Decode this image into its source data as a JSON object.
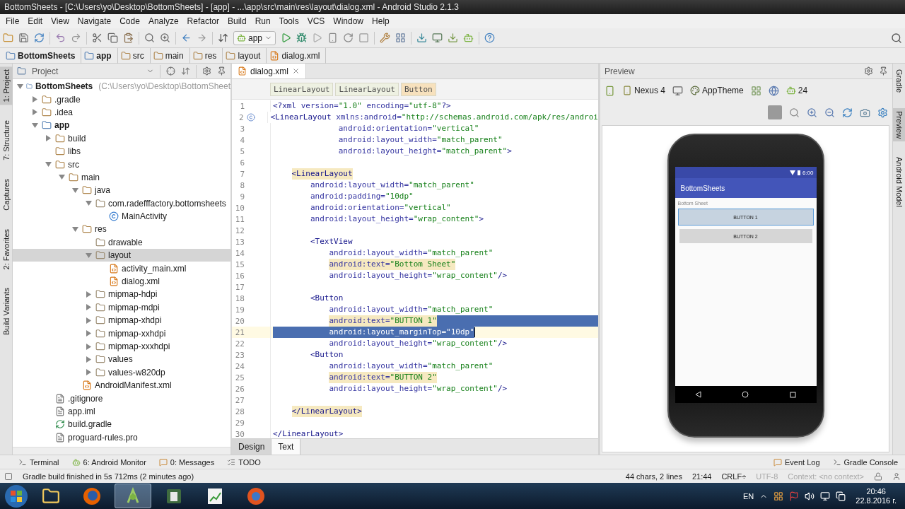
{
  "window": {
    "title": "BottomSheets - [C:\\Users\\yo\\Desktop\\BottomSheets] - [app] - ...\\app\\src\\main\\res\\layout\\dialog.xml - Android Studio 2.1.3"
  },
  "menu": [
    "File",
    "Edit",
    "View",
    "Navigate",
    "Code",
    "Analyze",
    "Refactor",
    "Build",
    "Run",
    "Tools",
    "VCS",
    "Window",
    "Help"
  ],
  "toolbar": {
    "run_config": "app"
  },
  "breadcrumb": [
    {
      "label": "BottomSheets",
      "kind": "module"
    },
    {
      "label": "app",
      "kind": "module"
    },
    {
      "label": "src",
      "kind": "folder"
    },
    {
      "label": "main",
      "kind": "folder"
    },
    {
      "label": "res",
      "kind": "folder"
    },
    {
      "label": "layout",
      "kind": "folder"
    },
    {
      "label": "dialog.xml",
      "kind": "xml"
    }
  ],
  "left_stripe": [
    {
      "label": "1: Project",
      "selected": true
    },
    {
      "label": "7: Structure",
      "selected": false
    },
    {
      "label": "Captures",
      "selected": false
    },
    {
      "label": "2: Favorites",
      "selected": false
    },
    {
      "label": "Build Variants",
      "selected": false
    }
  ],
  "project": {
    "title": "Project",
    "tree": [
      {
        "label": "BottomSheets",
        "path": "(C:\\Users\\yo\\Desktop\\BottomSheet",
        "kind": "module",
        "expanded": true,
        "selected": false,
        "children": [
          {
            "label": ".gradle",
            "kind": "folder",
            "expanded": false,
            "selected": false
          },
          {
            "label": ".idea",
            "kind": "folder",
            "expanded": false,
            "selected": false
          },
          {
            "label": "app",
            "kind": "module",
            "expanded": true,
            "selected": false,
            "children": [
              {
                "label": "build",
                "kind": "folder",
                "expanded": false,
                "selected": false
              },
              {
                "label": "libs",
                "kind": "folder",
                "selected": false
              },
              {
                "label": "src",
                "kind": "folder",
                "expanded": true,
                "selected": false,
                "children": [
                  {
                    "label": "main",
                    "kind": "folder",
                    "expanded": true,
                    "selected": false,
                    "children": [
                      {
                        "label": "java",
                        "kind": "folder",
                        "expanded": true,
                        "selected": false,
                        "children": [
                          {
                            "label": "com.radefffactory.bottomsheets",
                            "kind": "package",
                            "expanded": true,
                            "selected": false,
                            "children": [
                              {
                                "label": "MainActivity",
                                "kind": "class",
                                "selected": false
                              }
                            ]
                          }
                        ]
                      },
                      {
                        "label": "res",
                        "kind": "folder",
                        "expanded": true,
                        "selected": false,
                        "children": [
                          {
                            "label": "drawable",
                            "kind": "package",
                            "selected": false
                          },
                          {
                            "label": "layout",
                            "kind": "package",
                            "expanded": true,
                            "selected": true,
                            "children": [
                              {
                                "label": "activity_main.xml",
                                "kind": "xml",
                                "selected": false
                              },
                              {
                                "label": "dialog.xml",
                                "kind": "xml",
                                "selected": false
                              }
                            ]
                          },
                          {
                            "label": "mipmap-hdpi",
                            "kind": "package",
                            "expanded": false,
                            "selected": false
                          },
                          {
                            "label": "mipmap-mdpi",
                            "kind": "package",
                            "expanded": false,
                            "selected": false
                          },
                          {
                            "label": "mipmap-xhdpi",
                            "kind": "package",
                            "expanded": false,
                            "selected": false
                          },
                          {
                            "label": "mipmap-xxhdpi",
                            "kind": "package",
                            "expanded": false,
                            "selected": false
                          },
                          {
                            "label": "mipmap-xxxhdpi",
                            "kind": "package",
                            "expanded": false,
                            "selected": false
                          },
                          {
                            "label": "values",
                            "kind": "package",
                            "expanded": false,
                            "selected": false
                          },
                          {
                            "label": "values-w820dp",
                            "kind": "package",
                            "expanded": false,
                            "selected": false
                          }
                        ]
                      },
                      {
                        "label": "AndroidManifest.xml",
                        "kind": "xml",
                        "selected": false
                      }
                    ]
                  }
                ]
              },
              {
                "label": ".gitignore",
                "kind": "file",
                "selected": false
              },
              {
                "label": "app.iml",
                "kind": "file",
                "selected": false
              },
              {
                "label": "build.gradle",
                "kind": "gradle",
                "selected": false
              },
              {
                "label": "proguard-rules.pro",
                "kind": "file",
                "selected": false
              }
            ]
          }
        ]
      }
    ]
  },
  "editor": {
    "tabs": [
      {
        "label": "dialog.xml",
        "selected": true
      }
    ],
    "path": [
      {
        "label": "LinearLayout",
        "selected": false
      },
      {
        "label": "LinearLayout",
        "selected": false
      },
      {
        "label": "Button",
        "selected": true
      }
    ],
    "lines": [
      {
        "number": "1",
        "segments": [
          {
            "kind": "tag",
            "text": "<?xml"
          },
          {
            "kind": "attr",
            "text": " version="
          },
          {
            "kind": "value",
            "text": "\"1.0\""
          },
          {
            "kind": "attr",
            "text": " encoding="
          },
          {
            "kind": "value",
            "text": "\"utf-8\""
          },
          {
            "kind": "tag",
            "text": "?>"
          }
        ]
      },
      {
        "number": "2",
        "has_marker": true,
        "segments": [
          {
            "kind": "tag",
            "text": "<LinearLayout"
          },
          {
            "kind": "attr",
            "text": " xmlns:android="
          },
          {
            "kind": "value",
            "text": "\"http://schemas.android.com/apk/res/androi"
          }
        ]
      },
      {
        "number": "3",
        "segments": [
          {
            "kind": "attr",
            "text": "              android:orientation="
          },
          {
            "kind": "value",
            "text": "\"vertical\""
          }
        ]
      },
      {
        "number": "4",
        "segments": [
          {
            "kind": "attr",
            "text": "              android:layout_width="
          },
          {
            "kind": "value",
            "text": "\"match_parent\""
          }
        ]
      },
      {
        "number": "5",
        "segments": [
          {
            "kind": "attr",
            "text": "              android:layout_height="
          },
          {
            "kind": "value",
            "text": "\"match_parent\""
          },
          {
            "kind": "tag",
            "text": ">"
          }
        ]
      },
      {
        "number": "6"
      },
      {
        "number": "7",
        "segments": [
          {
            "kind": "tag",
            "text": "    <LinearLayout",
            "highlight": true
          }
        ]
      },
      {
        "number": "8",
        "segments": [
          {
            "kind": "attr",
            "text": "        android:layout_width="
          },
          {
            "kind": "value",
            "text": "\"match_parent\""
          }
        ]
      },
      {
        "number": "9",
        "segments": [
          {
            "kind": "attr",
            "text": "        android:padding="
          },
          {
            "kind": "value",
            "text": "\"10dp\""
          }
        ]
      },
      {
        "number": "10",
        "segments": [
          {
            "kind": "attr",
            "text": "        android:orientation="
          },
          {
            "kind": "value",
            "text": "\"vertical\""
          }
        ]
      },
      {
        "number": "11",
        "segments": [
          {
            "kind": "attr",
            "text": "        android:layout_height="
          },
          {
            "kind": "value",
            "text": "\"wrap_content\""
          },
          {
            "kind": "tag",
            "text": ">"
          }
        ]
      },
      {
        "number": "12"
      },
      {
        "number": "13",
        "segments": [
          {
            "kind": "tag",
            "text": "        <TextView"
          }
        ]
      },
      {
        "number": "14",
        "segments": [
          {
            "kind": "attr",
            "text": "            android:layout_width="
          },
          {
            "kind": "value",
            "text": "\"match_parent\""
          }
        ]
      },
      {
        "number": "15",
        "segments": [
          {
            "kind": "attr",
            "text": "            android:text=",
            "highlight": true
          },
          {
            "kind": "value",
            "text": "\"Bottom Sheet\"",
            "highlight": true
          }
        ]
      },
      {
        "number": "16",
        "segments": [
          {
            "kind": "attr",
            "text": "            android:layout_height="
          },
          {
            "kind": "value",
            "text": "\"wrap_content\""
          },
          {
            "kind": "tag",
            "text": "/>"
          }
        ]
      },
      {
        "number": "17"
      },
      {
        "number": "18",
        "segments": [
          {
            "kind": "tag",
            "text": "        <Button"
          }
        ]
      },
      {
        "number": "19",
        "segments": [
          {
            "kind": "attr",
            "text": "            android:layout_width="
          },
          {
            "kind": "value",
            "text": "\"match_parent\""
          }
        ]
      },
      {
        "number": "20",
        "selected_after": true,
        "segments": [
          {
            "kind": "attr",
            "text": "            android:text=",
            "highlight": true
          },
          {
            "kind": "value",
            "text": "\"BUTTON 1\"",
            "highlight": true
          }
        ]
      },
      {
        "number": "21",
        "selected": true,
        "caret": true,
        "segments": [
          {
            "kind": "attr",
            "text": "            android:layout_marginTop="
          },
          {
            "kind": "value",
            "text": "\"10dp\""
          }
        ]
      },
      {
        "number": "22",
        "segments": [
          {
            "kind": "attr",
            "text": "            android:layout_height="
          },
          {
            "kind": "value",
            "text": "\"wrap_content\""
          },
          {
            "kind": "tag",
            "text": "/>"
          }
        ]
      },
      {
        "number": "23",
        "segments": [
          {
            "kind": "tag",
            "text": "        <Button"
          }
        ]
      },
      {
        "number": "24",
        "segments": [
          {
            "kind": "attr",
            "text": "            android:layout_width="
          },
          {
            "kind": "value",
            "text": "\"match_parent\""
          }
        ]
      },
      {
        "number": "25",
        "segments": [
          {
            "kind": "attr",
            "text": "            android:text=",
            "highlight": true
          },
          {
            "kind": "value",
            "text": "\"BUTTON 2\"",
            "highlight": true
          }
        ]
      },
      {
        "number": "26",
        "segments": [
          {
            "kind": "attr",
            "text": "            android:layout_height="
          },
          {
            "kind": "value",
            "text": "\"wrap_content\""
          },
          {
            "kind": "tag",
            "text": "/>"
          }
        ]
      },
      {
        "number": "27"
      },
      {
        "number": "28",
        "segments": [
          {
            "kind": "tag",
            "text": "    </LinearLayout>",
            "highlight": true
          }
        ]
      },
      {
        "number": "29"
      },
      {
        "number": "30",
        "segments": [
          {
            "kind": "tag",
            "text": "</LinearLayout>"
          }
        ]
      }
    ],
    "mode_tabs": [
      {
        "label": "Design",
        "selected": false
      },
      {
        "label": "Text",
        "selected": true
      }
    ]
  },
  "preview": {
    "title": "Preview",
    "device": "Nexus 4",
    "theme": "AppTheme",
    "api": "24",
    "phone": {
      "time": "6:00",
      "app_title": "BottomSheets",
      "text": "Bottom Sheet",
      "buttons": [
        {
          "label": "BUTTON 1",
          "selected": true
        },
        {
          "label": "BUTTON 2",
          "selected": false
        }
      ]
    }
  },
  "right_stripe": [
    {
      "label": "Gradle",
      "selected": false
    },
    {
      "label": "Preview",
      "selected": true
    },
    {
      "label": "Android Model",
      "selected": false
    }
  ],
  "tool_windows": {
    "left": [
      {
        "label": "Terminal",
        "kind": "terminal"
      },
      {
        "label": "6: Android Monitor",
        "kind": "android"
      },
      {
        "label": "0: Messages",
        "kind": "messages"
      },
      {
        "label": "TODO",
        "kind": "todo"
      }
    ],
    "right": [
      {
        "label": "Event Log",
        "kind": "messages"
      },
      {
        "label": "Gradle Console",
        "kind": "terminal"
      }
    ]
  },
  "status_bar": {
    "message": "Gradle build finished in 5s 712ms (2 minutes ago)",
    "items": [
      {
        "text": "44 chars, 2 lines",
        "disabled": false
      },
      {
        "text": "21:44",
        "disabled": false
      },
      {
        "text": "CRLF÷",
        "disabled": false
      },
      {
        "text": "UTF-8",
        "disabled": true
      },
      {
        "text": "Context: <no context>",
        "disabled": true
      }
    ]
  },
  "taskbar": {
    "apps": [
      {
        "kind": "folder",
        "selected": false
      },
      {
        "kind": "fox",
        "selected": false
      },
      {
        "kind": "android",
        "selected": true
      },
      {
        "kind": "green",
        "selected": false
      },
      {
        "kind": "chart",
        "selected": false
      },
      {
        "kind": "browser",
        "selected": false
      }
    ],
    "language": "EN",
    "time": "20:46",
    "date": "22.8.2016 г."
  }
}
